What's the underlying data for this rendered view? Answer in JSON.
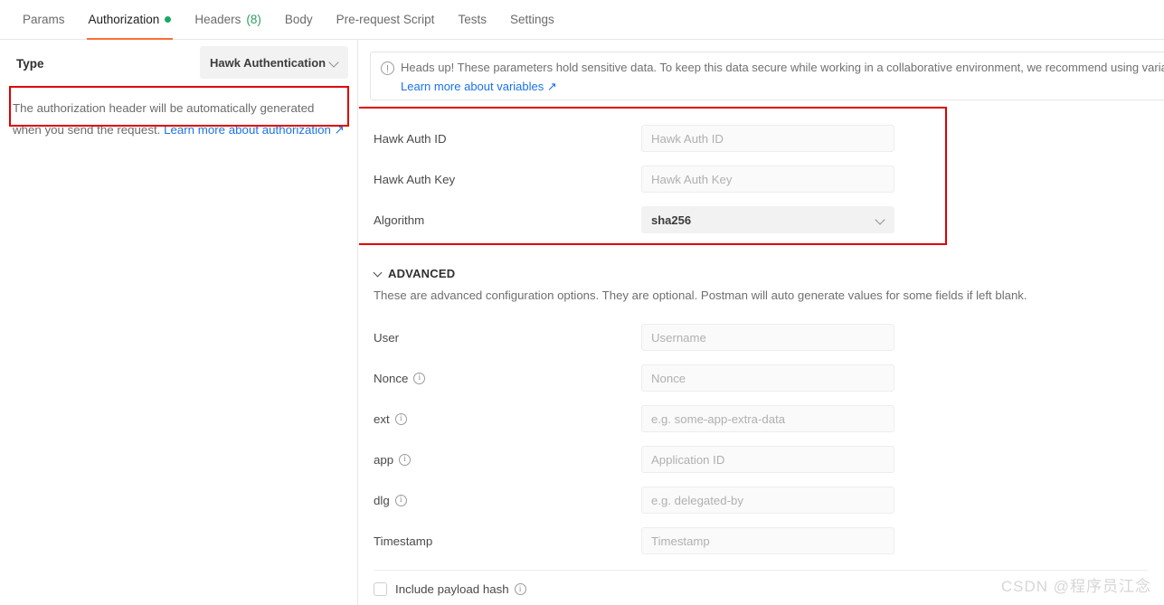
{
  "tabs": [
    {
      "label": "Params",
      "active": false,
      "dot": false,
      "count": ""
    },
    {
      "label": "Authorization",
      "active": true,
      "dot": true,
      "count": ""
    },
    {
      "label": "Headers",
      "active": false,
      "dot": false,
      "count": "(8)"
    },
    {
      "label": "Body",
      "active": false,
      "dot": false,
      "count": ""
    },
    {
      "label": "Pre-request Script",
      "active": false,
      "dot": false,
      "count": ""
    },
    {
      "label": "Tests",
      "active": false,
      "dot": false,
      "count": ""
    },
    {
      "label": "Settings",
      "active": false,
      "dot": false,
      "count": ""
    }
  ],
  "left": {
    "type_label": "Type",
    "type_value": "Hawk Authentication",
    "helper_prefix": "The authorization header will be automatically generated when you send the request. ",
    "helper_link": "Learn more about authorization ↗"
  },
  "banner": {
    "text": "Heads up! These parameters hold sensitive data. To keep this data secure while working in a collaborative environment, we recommend using variable",
    "link": "Learn more about variables ↗"
  },
  "auth_fields": [
    {
      "label": "Hawk Auth ID",
      "placeholder": "Hawk Auth ID",
      "type": "input",
      "info": false
    },
    {
      "label": "Hawk Auth Key",
      "placeholder": "Hawk Auth Key",
      "type": "input",
      "info": false
    },
    {
      "label": "Algorithm",
      "value": "sha256",
      "type": "select",
      "info": false
    }
  ],
  "advanced": {
    "title": "ADVANCED",
    "description": "These are advanced configuration options. They are optional. Postman will auto generate values for some fields if left blank.",
    "fields": [
      {
        "label": "User",
        "placeholder": "Username",
        "type": "input",
        "info": false
      },
      {
        "label": "Nonce",
        "placeholder": "Nonce",
        "type": "input",
        "info": true
      },
      {
        "label": "ext",
        "placeholder": "e.g. some-app-extra-data",
        "type": "input",
        "info": true
      },
      {
        "label": "app",
        "placeholder": "Application ID",
        "type": "input",
        "info": true
      },
      {
        "label": "dlg",
        "placeholder": "e.g. delegated-by",
        "type": "input",
        "info": true
      },
      {
        "label": "Timestamp",
        "placeholder": "Timestamp",
        "type": "input",
        "info": false
      }
    ],
    "checkbox_label": "Include payload hash",
    "checkbox_checked": false
  },
  "watermark": "CSDN @程序员江念",
  "colors": {
    "accent": "#ff6c37",
    "green_dot": "#19a864",
    "link": "#1a73e8",
    "annotation_red": "#e00000",
    "count_green": "#2b9e5f"
  }
}
